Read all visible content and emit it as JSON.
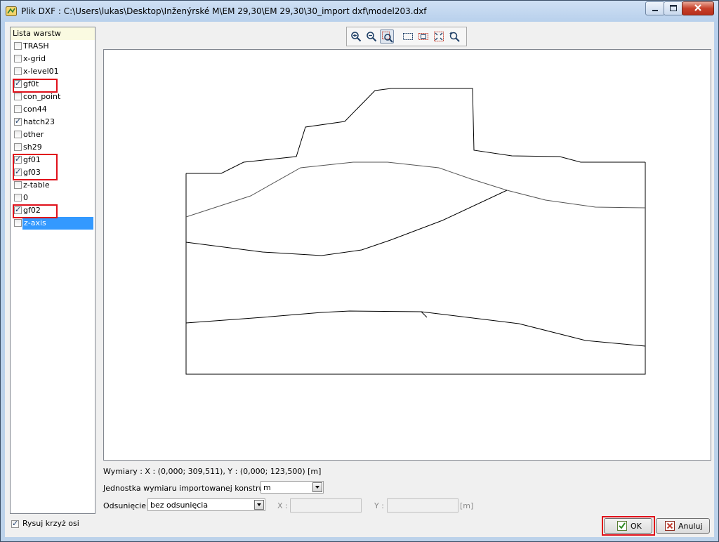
{
  "window": {
    "title": "Plik DXF : C:\\Users\\lukas\\Desktop\\Inženýrské M\\EM 29,30\\EM 29,30\\30_import dxf\\model203.dxf"
  },
  "layer_list": {
    "header": "Lista warstw",
    "items": [
      {
        "label": "TRASH",
        "checked": false
      },
      {
        "label": "x-grid",
        "checked": false
      },
      {
        "label": "x-level01",
        "checked": false
      },
      {
        "label": "gf0t",
        "checked": true,
        "highlighted": true
      },
      {
        "label": "con_point",
        "checked": false
      },
      {
        "label": "con44",
        "checked": false
      },
      {
        "label": "hatch23",
        "checked": true
      },
      {
        "label": "other",
        "checked": false
      },
      {
        "label": "sh29",
        "checked": false
      },
      {
        "label": "gf01",
        "checked": true,
        "highlighted": true
      },
      {
        "label": "gf03",
        "checked": true,
        "highlighted": true
      },
      {
        "label": "z-table",
        "checked": false
      },
      {
        "label": "0",
        "checked": false
      },
      {
        "label": "gf02",
        "checked": true,
        "highlighted": true
      },
      {
        "label": "z-axis",
        "checked": false,
        "selected": true
      }
    ]
  },
  "toolbar": {
    "tools": [
      "zoom-in-icon",
      "zoom-out-icon",
      "zoom-window-icon",
      "select-window-icon",
      "select-crossing-icon",
      "zoom-extents-icon",
      "zoom-previous-icon"
    ],
    "active_tool": "zoom-window-icon"
  },
  "form": {
    "dimensions": "Wymiary : X : (0,000; 309,511), Y : (0,000; 123,500) [m]",
    "unit_label": "Jednostka wymiaru importowanej konstrukcji :",
    "unit_value": "m",
    "offset_label": "Odsunięcie :",
    "offset_value": "bez odsunięcia",
    "x_label": "X :",
    "y_label": "Y :",
    "offset_unit": "[m]"
  },
  "footer": {
    "axis_cross_label": "Rysuj krzyż osi",
    "axis_cross_checked": true,
    "ok_label": "OK",
    "cancel_label": "Anuluj"
  },
  "colors": {
    "highlight_box": "#e0101a",
    "selection": "#3399ff",
    "header_bg": "#fafae1"
  }
}
